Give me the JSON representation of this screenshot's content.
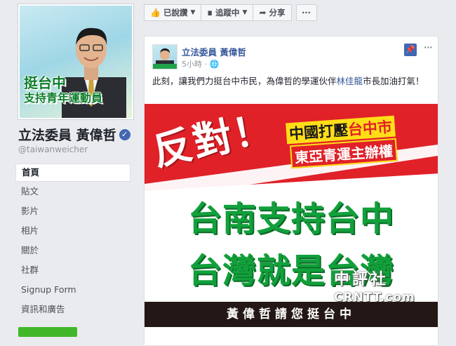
{
  "profile": {
    "badge_line1": "挺台中",
    "badge_line2": "支持青年運動員",
    "name": "立法委員 黃偉哲",
    "handle": "@taiwanweicher"
  },
  "nav": {
    "items": [
      {
        "label": "首頁",
        "active": true
      },
      {
        "label": "貼文"
      },
      {
        "label": "影片"
      },
      {
        "label": "相片"
      },
      {
        "label": "關於"
      },
      {
        "label": "社群"
      },
      {
        "label": "Signup Form"
      },
      {
        "label": "資訊和廣告"
      }
    ]
  },
  "actionbar": {
    "liked": "已說讚",
    "following": "追蹤中",
    "share": "分享",
    "more": "···"
  },
  "post": {
    "author": "立法委員 黃偉哲",
    "time": "5小時",
    "text_before": "此刻，讓我們力挺台中市民，為偉哲的學運伙伴",
    "mention": "林佳龍",
    "text_after": "市長加油打氣！",
    "more": "···"
  },
  "poster": {
    "oppose": "反對！",
    "yellow_part1": "中國打壓",
    "yellow_part2": "台中市",
    "red_line": "東亞青運主辦權",
    "green_line1": "台南支持台中",
    "green_line2": "台灣就是台灣",
    "black_band": "黃偉哲請您挺台中",
    "watermark1": "中評社",
    "watermark2": "CRNTT.com"
  },
  "colors": {
    "fb_blue": "#4267b2",
    "link_blue": "#365899",
    "poster_red": "#e02128",
    "poster_green": "#12a03b",
    "poster_yellow": "#ffde17"
  }
}
